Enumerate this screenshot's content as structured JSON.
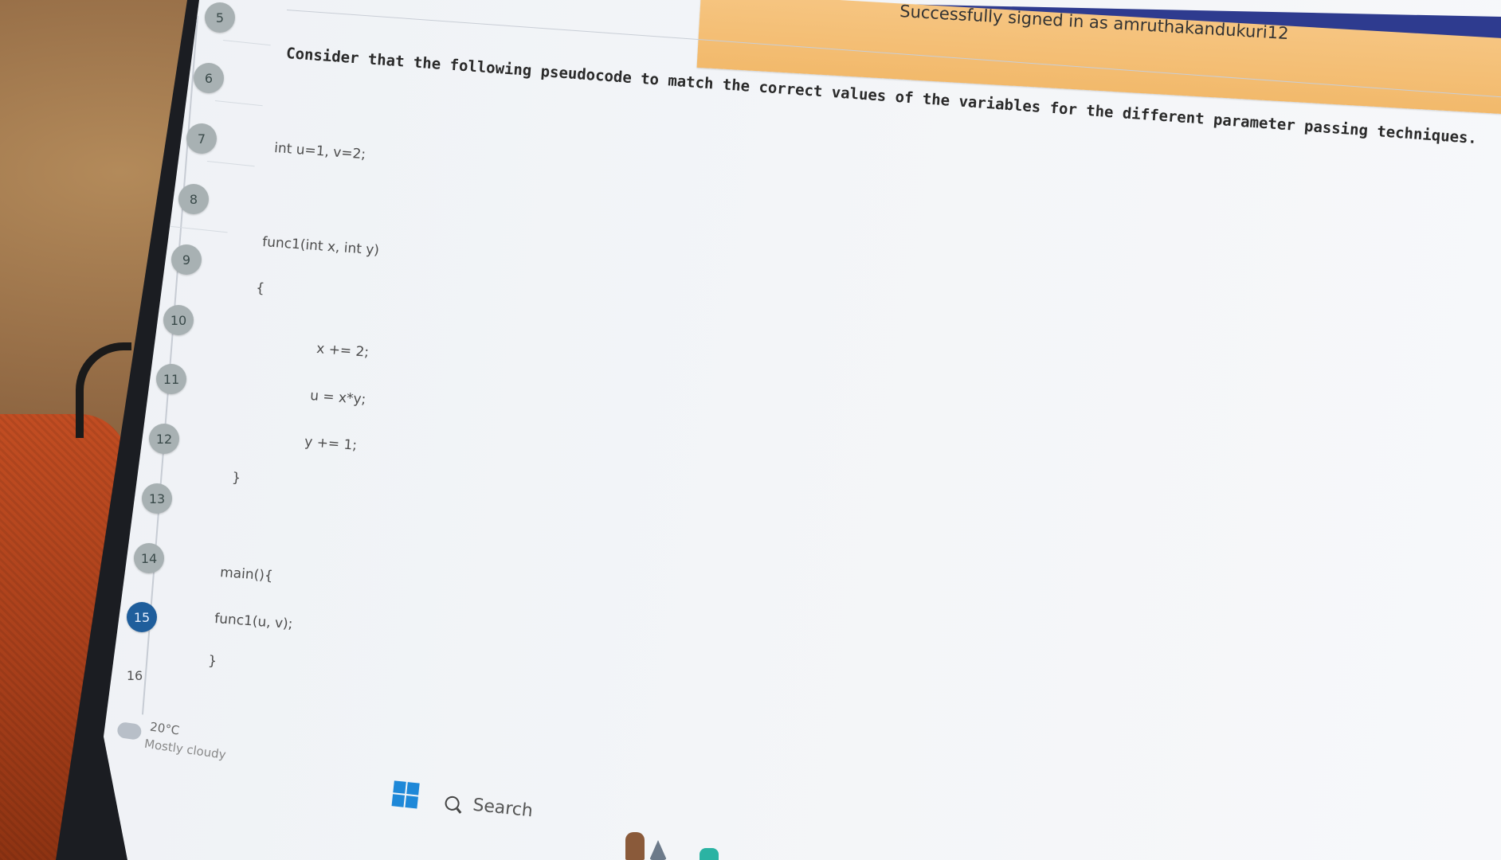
{
  "banner": {
    "text": "Successfully signed in as amruthakandukuri12"
  },
  "navigator": {
    "questions": [
      {
        "label": "5",
        "state": "answered"
      },
      {
        "label": "6",
        "state": "answered"
      },
      {
        "label": "7",
        "state": "answered"
      },
      {
        "label": "8",
        "state": "answered"
      },
      {
        "label": "9",
        "state": "answered"
      },
      {
        "label": "10",
        "state": "answered"
      },
      {
        "label": "11",
        "state": "answered"
      },
      {
        "label": "12",
        "state": "answered"
      },
      {
        "label": "13",
        "state": "answered"
      },
      {
        "label": "14",
        "state": "answered"
      },
      {
        "label": "15",
        "state": "current"
      },
      {
        "label": "16",
        "state": "unvisited"
      }
    ]
  },
  "question": {
    "text": "Consider that the following pseudocode to match the correct values of the variables for the different parameter passing techniques.",
    "code": [
      "int u=1, v=2;",
      "func1(int x, int y)",
      "{",
      "x += 2;",
      "u = x*y;",
      "y += 1;",
      "}",
      "main(){",
      "func1(u, v);",
      "}"
    ]
  },
  "taskbar": {
    "weather_temp": "20°C",
    "weather_desc": "Mostly cloudy",
    "search_label": "Search"
  },
  "colors": {
    "current_question": "#1f5e9c",
    "answered_question": "#a8b1b3",
    "banner": "#f2b96b",
    "top_bar": "#2e3b8f"
  }
}
